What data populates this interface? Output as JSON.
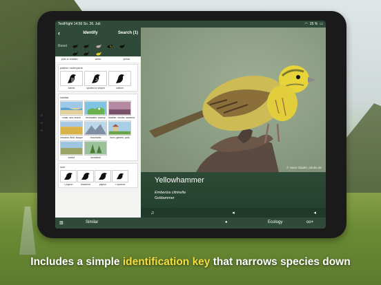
{
  "status_bar": {
    "app": "TestFlight",
    "time": "14:56",
    "date": "So. 26. Juli",
    "battery": "25 %"
  },
  "nav": {
    "title": "Identify",
    "search_label": "Search (1)"
  },
  "color_row": {
    "reset_label": "Reset",
    "labels": [
      "pink or reddish",
      "white",
      "yellow"
    ]
  },
  "pattern": {
    "caption": "pattern underparts",
    "tiles": [
      "barred",
      "spotted or striped",
      "uniform"
    ]
  },
  "habitat": {
    "caption": "habitat",
    "tiles": [
      "coast, sea, beach",
      "freshwater, swamp",
      "heather, shrubs, savanna",
      "meadow, field, steppe",
      "mountains",
      "town, garden, park",
      "tundra",
      "woodland"
    ]
  },
  "size": {
    "caption": "size",
    "tiles": [
      "< pigeon",
      "blackbird",
      "pigeon",
      "< sparrow"
    ]
  },
  "bird": {
    "name": "Yellowhammer",
    "latin": "Emberiza citrinella",
    "alt_name": "Goldammer",
    "credit": "© Hans Glader, adobe.de"
  },
  "tabs": {
    "similar": "Similar",
    "ecology": "Ecology"
  },
  "caption": {
    "before": "Includes a simple ",
    "highlight": "identification key",
    "after": " that narrows species down"
  },
  "colors": {
    "app_green": "#2f4a38",
    "highlight": "#f4dc3c"
  }
}
